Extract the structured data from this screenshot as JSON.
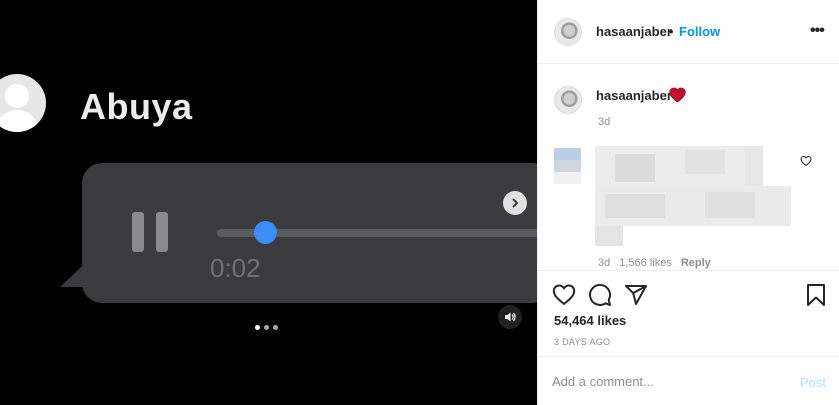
{
  "media": {
    "contact_name": "Abuya",
    "elapsed_time": "0:02",
    "playback_progress": 0.1,
    "carousel": {
      "slide_count": 3,
      "active_slide": 1
    },
    "colors": {
      "background": "#000000",
      "bubble": "#3b3b3d",
      "scrubber_knob": "#3a8ef6"
    }
  },
  "header": {
    "username": "hasaanjaber",
    "separator": "•",
    "follow_label": "Follow",
    "more_label": "•••"
  },
  "caption": {
    "username": "hasaanjaber",
    "emoji": "heart-emoji",
    "age": "3d"
  },
  "comment": {
    "text_redacted": true,
    "age": "3d",
    "likes": "1,566 likes",
    "reply_label": "Reply"
  },
  "actions": {
    "icons": [
      "heart-icon",
      "comment-icon",
      "share-icon",
      "bookmark-icon"
    ],
    "likes": "54,464 likes",
    "date": "3 DAYS AGO"
  },
  "comment_box": {
    "placeholder": "Add a comment...",
    "post_label": "Post"
  },
  "colors": {
    "accent": "#0095f6",
    "muted": "#8e8e8e",
    "heart": "#ed4956"
  }
}
